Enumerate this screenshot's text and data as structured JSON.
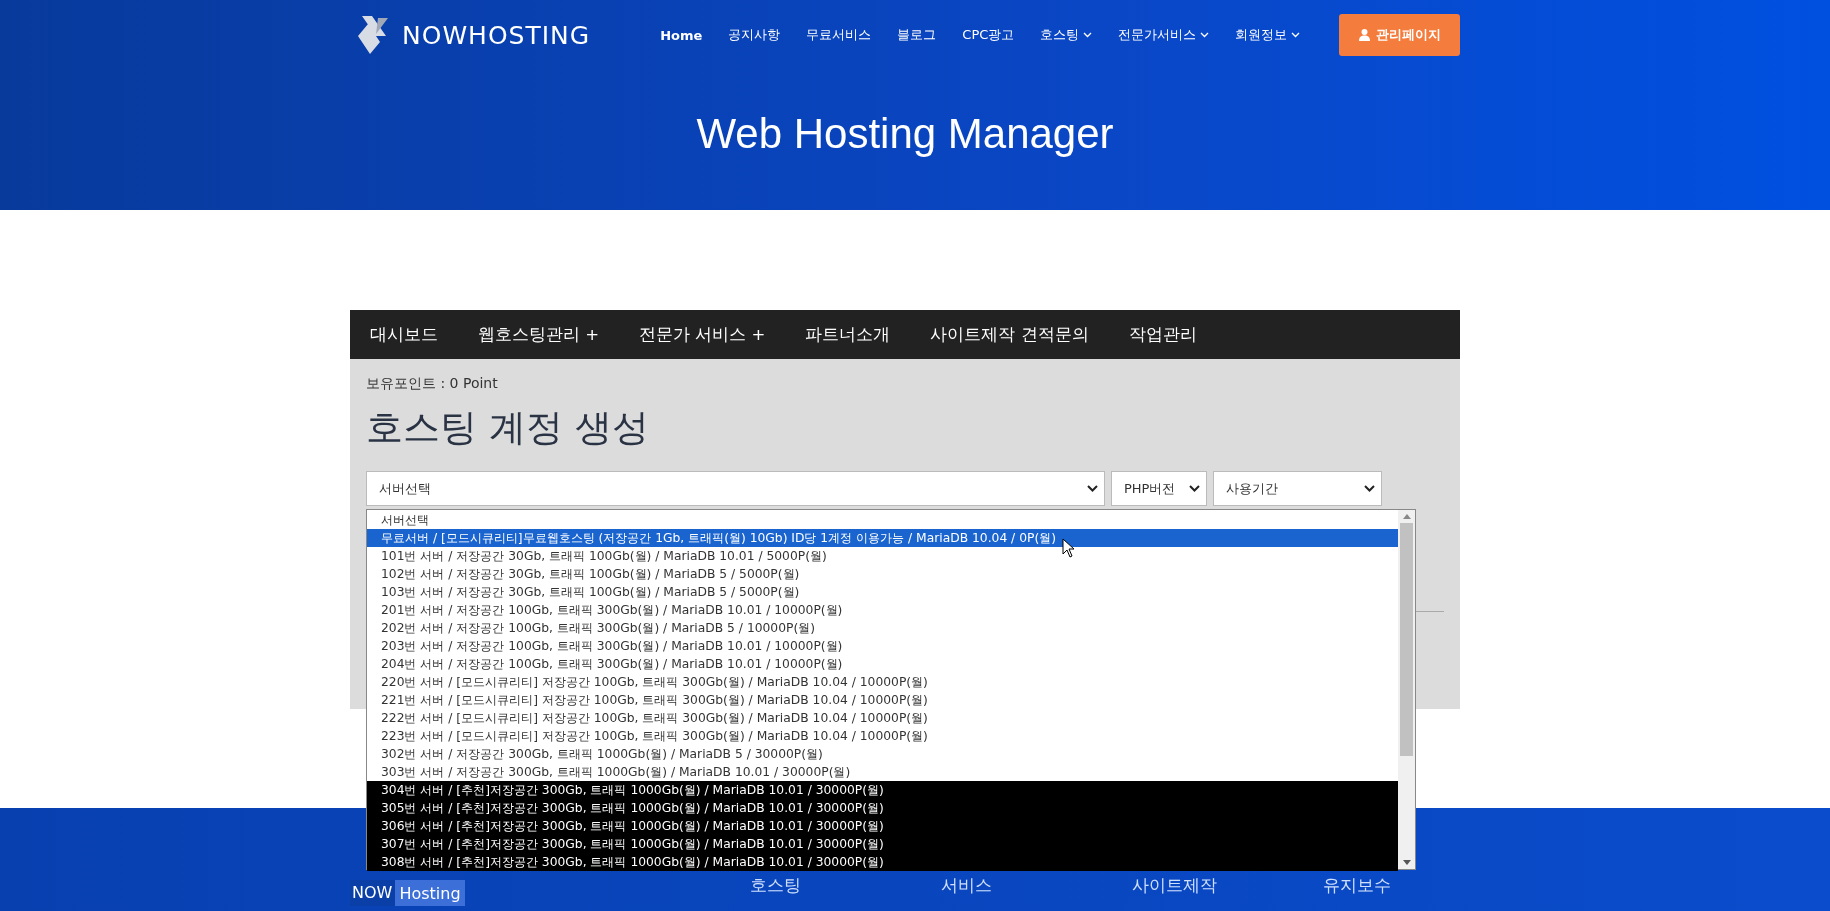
{
  "header": {
    "logo": "NOWHOSTING",
    "nav": [
      {
        "label": "Home",
        "has_menu": false
      },
      {
        "label": "공지사항",
        "has_menu": false
      },
      {
        "label": "무료서비스",
        "has_menu": false
      },
      {
        "label": "블로그",
        "has_menu": false
      },
      {
        "label": "CPC광고",
        "has_menu": false
      },
      {
        "label": "호스팅",
        "has_menu": true
      },
      {
        "label": "전문가서비스",
        "has_menu": true
      },
      {
        "label": "회원정보",
        "has_menu": true
      }
    ],
    "admin_button": "관리페이지",
    "title": "Web Hosting Manager"
  },
  "menu": [
    {
      "label": "대시보드"
    },
    {
      "label": "웹호스팅관리 +"
    },
    {
      "label": "전문가 서비스 +"
    },
    {
      "label": "파트너소개"
    },
    {
      "label": "사이트제작 견적문의"
    },
    {
      "label": "작업관리"
    }
  ],
  "points": "보유포인트 : 0 Point",
  "heading": "호스팅 계정 생성",
  "selects": {
    "server": "서버선택",
    "php": "PHP버전",
    "period": "사용기간"
  },
  "options": [
    {
      "label": "서버선택",
      "kind": "normal",
      "selected": false
    },
    {
      "label": "무료서버 / [모드시큐리티]무료웹호스팅 (저장공간 1Gb, 트래픽(월) 10Gb) ID당 1계정 이용가능 / MariaDB 10.04 / 0P(월)",
      "kind": "normal",
      "selected": true
    },
    {
      "label": "101번 서버 / 저장공간 30Gb, 트래픽 100Gb(월) / MariaDB 10.01 / 5000P(월)",
      "kind": "normal",
      "selected": false
    },
    {
      "label": "102번 서버 / 저장공간 30Gb, 트래픽 100Gb(월) / MariaDB 5 / 5000P(월)",
      "kind": "normal",
      "selected": false
    },
    {
      "label": "103번 서버 / 저장공간 30Gb, 트래픽 100Gb(월) / MariaDB 5 / 5000P(월)",
      "kind": "normal",
      "selected": false
    },
    {
      "label": "201번 서버 / 저장공간 100Gb, 트래픽 300Gb(월) / MariaDB 10.01 / 10000P(월)",
      "kind": "normal",
      "selected": false
    },
    {
      "label": "202번 서버 / 저장공간 100Gb, 트래픽 300Gb(월) / MariaDB 5 / 10000P(월)",
      "kind": "normal",
      "selected": false
    },
    {
      "label": "203번 서버 / 저장공간 100Gb, 트래픽 300Gb(월) / MariaDB 10.01 / 10000P(월)",
      "kind": "normal",
      "selected": false
    },
    {
      "label": "204번 서버 / 저장공간 100Gb, 트래픽 300Gb(월) / MariaDB 10.01 / 10000P(월)",
      "kind": "normal",
      "selected": false
    },
    {
      "label": "220번 서버 / [모드시큐리티] 저장공간 100Gb, 트래픽 300Gb(월) / MariaDB 10.04 / 10000P(월)",
      "kind": "normal",
      "selected": false
    },
    {
      "label": "221번 서버 / [모드시큐리티] 저장공간 100Gb, 트래픽 300Gb(월) / MariaDB 10.04 / 10000P(월)",
      "kind": "normal",
      "selected": false
    },
    {
      "label": "222번 서버 / [모드시큐리티] 저장공간 100Gb, 트래픽 300Gb(월) / MariaDB 10.04 / 10000P(월)",
      "kind": "normal",
      "selected": false
    },
    {
      "label": "223번 서버 / [모드시큐리티] 저장공간 100Gb, 트래픽 300Gb(월) / MariaDB 10.04 / 10000P(월)",
      "kind": "normal",
      "selected": false
    },
    {
      "label": "302번 서버 / 저장공간 300Gb, 트래픽 1000Gb(월) / MariaDB 5 / 30000P(월)",
      "kind": "normal",
      "selected": false
    },
    {
      "label": "303번 서버 / 저장공간 300Gb, 트래픽 1000Gb(월) / MariaDB 10.01 / 30000P(월)",
      "kind": "normal",
      "selected": false
    },
    {
      "label": "304번 서버 / [추천]저장공간 300Gb, 트래픽 1000Gb(월) / MariaDB 10.01 / 30000P(월)",
      "kind": "featured",
      "selected": false
    },
    {
      "label": "305번 서버 / [추천]저장공간 300Gb, 트래픽 1000Gb(월) / MariaDB 10.01 / 30000P(월)",
      "kind": "featured",
      "selected": false
    },
    {
      "label": "306번 서버 / [추천]저장공간 300Gb, 트래픽 1000Gb(월) / MariaDB 10.01 / 30000P(월)",
      "kind": "featured",
      "selected": false
    },
    {
      "label": "307번 서버 / [추천]저장공간 300Gb, 트래픽 1000Gb(월) / MariaDB 10.01 / 30000P(월)",
      "kind": "featured",
      "selected": false
    },
    {
      "label": "308번 서버 / [추천]저장공간 300Gb, 트래픽 1000Gb(월) / MariaDB 10.01 / 30000P(월)",
      "kind": "featured",
      "selected": false
    }
  ],
  "footer": {
    "brand": [
      "NOW",
      "Hosting"
    ],
    "links": [
      "호스팅",
      "서비스",
      "사이트제작",
      "유지보수"
    ]
  }
}
